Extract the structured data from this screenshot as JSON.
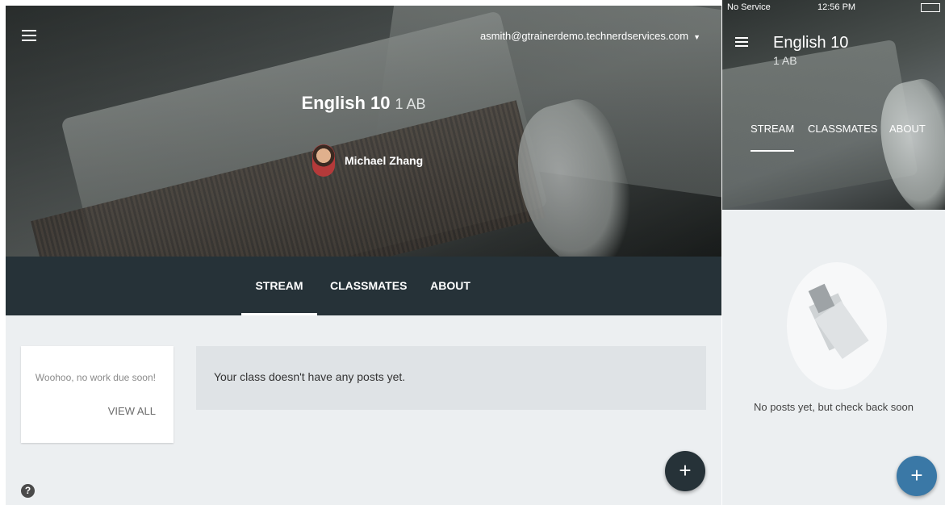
{
  "desktop": {
    "account_email": "asmith@gtrainerdemo.technerdservices.com",
    "course_name": "English 10",
    "course_section": "1 AB",
    "teacher_name": "Michael Zhang",
    "tabs": [
      "STREAM",
      "CLASSMATES",
      "ABOUT"
    ],
    "upcoming_message": "Woohoo, no work due soon!",
    "view_all": "VIEW ALL",
    "empty_stream": "Your class doesn't have any posts yet.",
    "fab_label": "+",
    "help_label": "?"
  },
  "mobile": {
    "status_carrier": "No Service",
    "status_time": "12:56 PM",
    "course_name": "English 10",
    "course_section": "1 AB",
    "tabs": [
      "STREAM",
      "CLASSMATES",
      "ABOUT"
    ],
    "empty_message": "No posts yet, but check back soon",
    "fab_label": "+"
  },
  "colors": {
    "tab_bar": "#263238",
    "fab_mobile": "#3a78a6",
    "background": "#eceff1"
  }
}
